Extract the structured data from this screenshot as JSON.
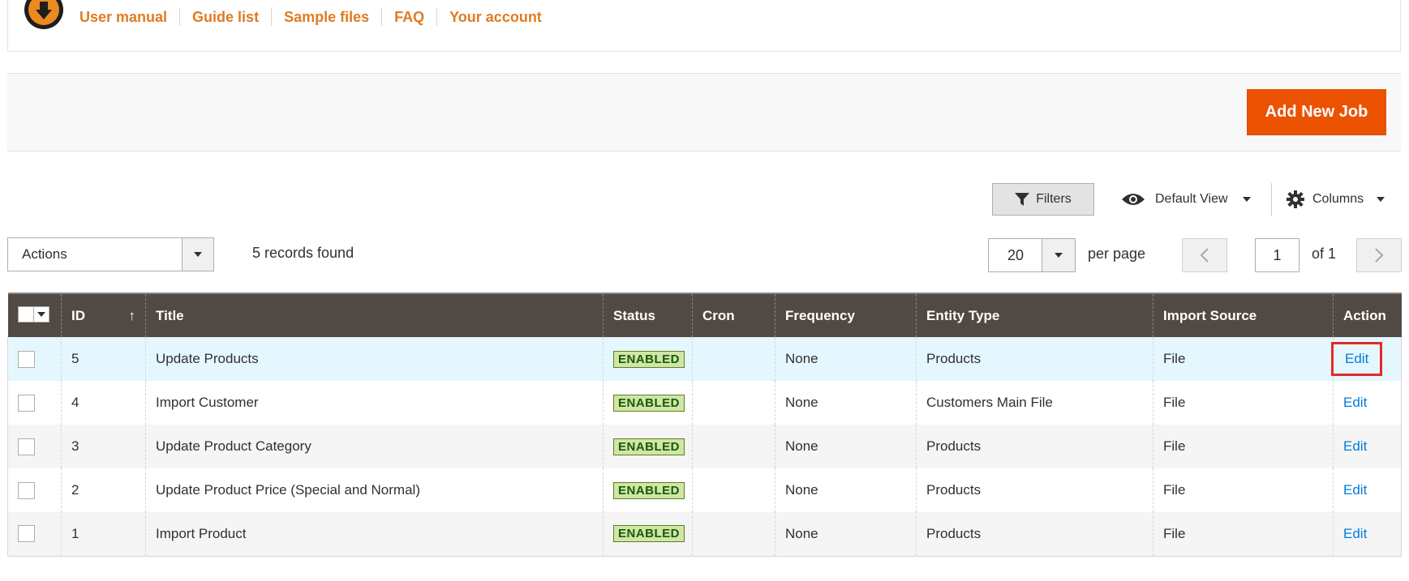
{
  "help": {
    "links": [
      "User manual",
      "Guide list",
      "Sample files",
      "FAQ",
      "Your account"
    ]
  },
  "page_actions": {
    "add_new_job": "Add New Job"
  },
  "toolbar": {
    "filters": "Filters",
    "view": "Default View",
    "columns": "Columns",
    "actions": "Actions",
    "records_found": "5 records found",
    "per_page_value": "20",
    "per_page_label": "per page",
    "current_page": "1",
    "page_of": "of 1"
  },
  "grid": {
    "headers": {
      "id": "ID",
      "title": "Title",
      "status": "Status",
      "cron": "Cron",
      "frequency": "Frequency",
      "entity_type": "Entity Type",
      "import_source": "Import Source",
      "action": "Action"
    },
    "sort_indicator": "↑",
    "rows": [
      {
        "id": "5",
        "title": "Update Products",
        "status": "ENABLED",
        "cron": "",
        "frequency": "None",
        "entity_type": "Products",
        "import_source": "File",
        "action": "Edit"
      },
      {
        "id": "4",
        "title": "Import Customer",
        "status": "ENABLED",
        "cron": "",
        "frequency": "None",
        "entity_type": "Customers Main File",
        "import_source": "File",
        "action": "Edit"
      },
      {
        "id": "3",
        "title": "Update Product Category",
        "status": "ENABLED",
        "cron": "",
        "frequency": "None",
        "entity_type": "Products",
        "import_source": "File",
        "action": "Edit"
      },
      {
        "id": "2",
        "title": "Update Product Price (Special and Normal)",
        "status": "ENABLED",
        "cron": "",
        "frequency": "None",
        "entity_type": "Products",
        "import_source": "File",
        "action": "Edit"
      },
      {
        "id": "1",
        "title": "Import Product",
        "status": "ENABLED",
        "cron": "",
        "frequency": "None",
        "entity_type": "Products",
        "import_source": "File",
        "action": "Edit"
      }
    ]
  },
  "colors": {
    "brand_orange": "#eb5202",
    "link_orange": "#e07b22",
    "header_bg": "#514943",
    "highlight": "#e02b27"
  }
}
